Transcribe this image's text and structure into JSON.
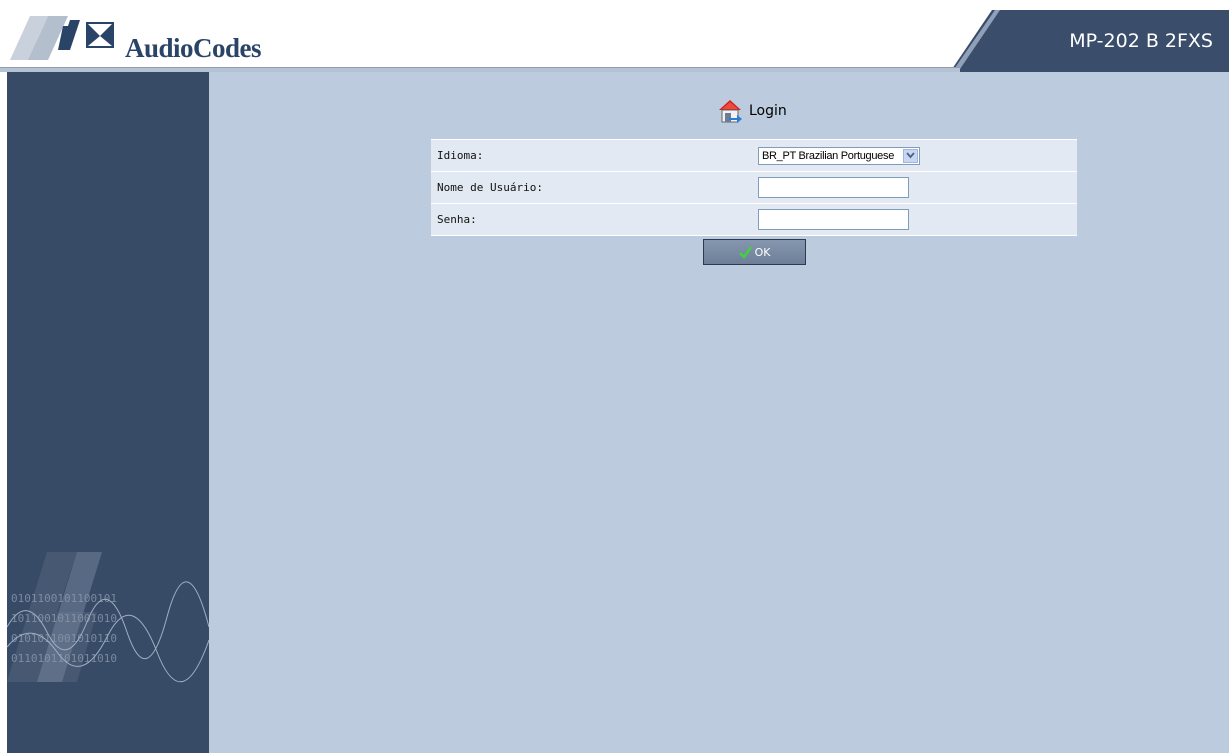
{
  "header": {
    "brand": "AudioCodes",
    "product": "MP-202 B 2FXS"
  },
  "login": {
    "title": "Login",
    "fields": {
      "language_label": "Idioma:",
      "language_value": "BR_PT Brazilian Portuguese",
      "username_label": "Nome de Usuário:",
      "username_value": "",
      "password_label": "Senha:",
      "password_value": ""
    },
    "ok_label": "OK"
  },
  "colors": {
    "header_band": "#3a4d6a",
    "sidebar": "#384b66",
    "content_bg": "#bccbdd",
    "row_bg": "#e3e9f2",
    "button": "#7a8aa3"
  },
  "icons": {
    "brand_logo": "audiocodes-logo",
    "login": "house-login-icon",
    "ok": "checkmark-icon",
    "dropdown": "chevron-down-icon"
  }
}
